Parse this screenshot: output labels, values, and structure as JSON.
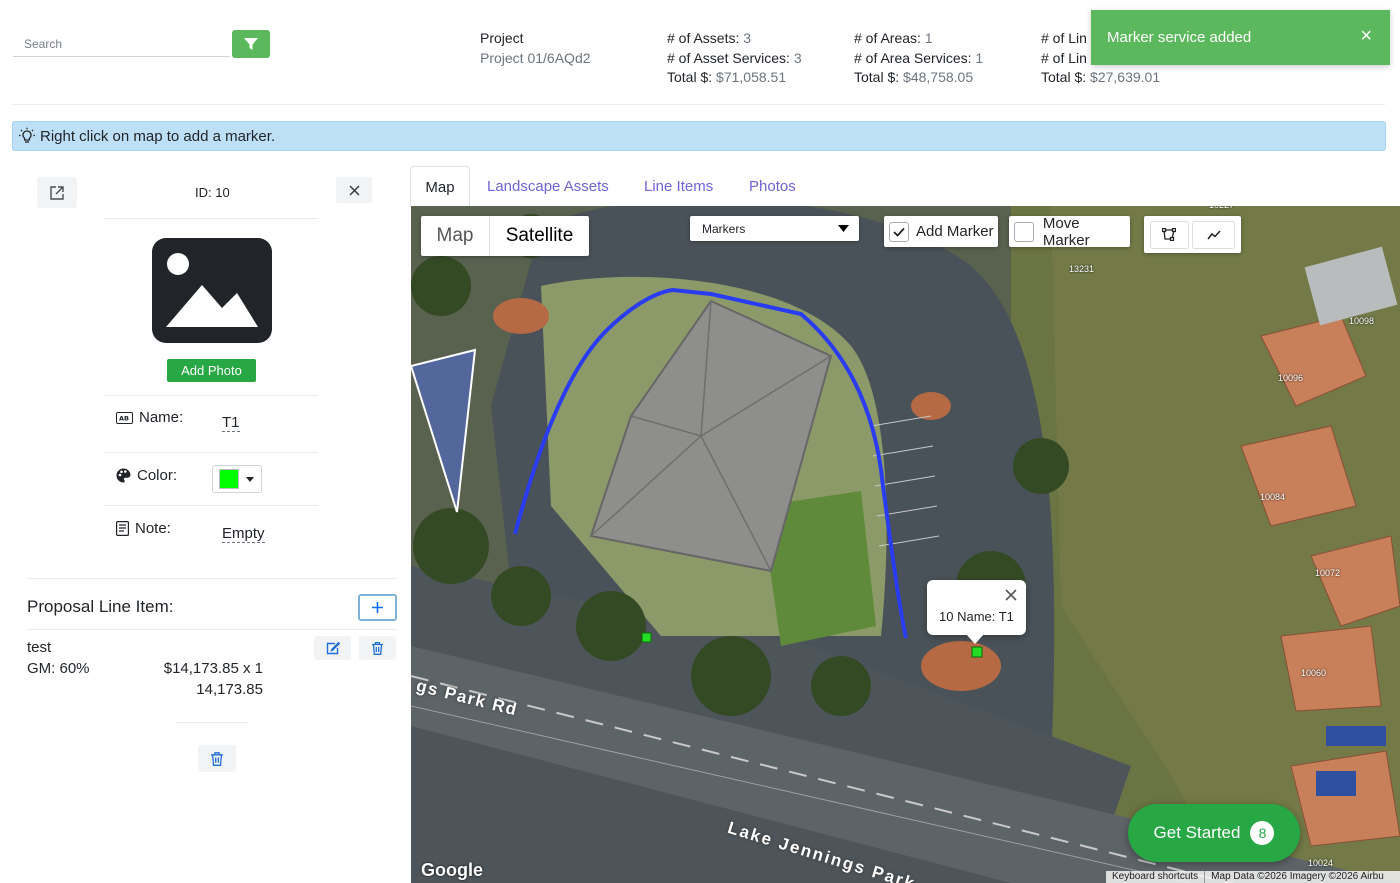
{
  "search": {
    "placeholder": "Search"
  },
  "project": {
    "label": "Project",
    "name": "Project 01/6AQd2"
  },
  "stats": {
    "assets": {
      "label": "# of Assets:",
      "value": "3",
      "services_label": "# of Asset Services:",
      "services_value": "3",
      "total_label": "Total $:",
      "total_value": "$71,058.51"
    },
    "areas": {
      "label": "# of Areas:",
      "value": "1",
      "services_label": "# of Area Services:",
      "services_value": "1",
      "total_label": "Total $:",
      "total_value": "$48,758.05"
    },
    "lines": {
      "label": "# of Lin",
      "services_label": "# of Lin",
      "total_label": "Total $:",
      "total_value": "$27,639.01"
    }
  },
  "toast": {
    "message": "Marker service added",
    "close": "×"
  },
  "info": {
    "message": "Right click on map to add a marker."
  },
  "detail": {
    "id_text": "ID: 10",
    "add_photo": "Add Photo",
    "name_label": "Name:",
    "name_value": "T1",
    "color_label": "Color:",
    "color_value": "#00ff00",
    "note_label": "Note:",
    "note_value": "Empty",
    "proposal_label": "Proposal Line Item:",
    "line_item": {
      "name": "test",
      "gm": "GM: 60%",
      "price_qty": "$14,173.85 x 1",
      "total": "14,173.85"
    }
  },
  "tabs": [
    {
      "label": "Map",
      "active": true
    },
    {
      "label": "Landscape Assets"
    },
    {
      "label": "Line Items"
    },
    {
      "label": "Photos"
    }
  ],
  "map": {
    "type_map": "Map",
    "type_satellite": "Satellite",
    "layer_select": "Markers",
    "add_marker": "Add Marker",
    "move_marker": "Move Marker",
    "add_marker_checked": true,
    "move_marker_checked": false,
    "info_window": "10 Name: T1",
    "roads": [
      "gs Park Rd",
      "Lake Jennings Park"
    ],
    "house_numbers": [
      "10227",
      "13231",
      "10098",
      "10096",
      "10084",
      "10072",
      "10060",
      "10024"
    ],
    "attribution": {
      "logo": "Google",
      "shortcuts": "Keyboard shortcuts",
      "data": "Map Data ©2026 Imagery ©2026 Airbu"
    }
  },
  "get_started": {
    "label": "Get Started",
    "count": "8"
  },
  "colors": {
    "accent_green": "#5cb85c",
    "button_green": "#28a745",
    "info_blue": "#bee0f6",
    "tab_purple": "#6f63d8",
    "polyline_blue": "#2a3cf0"
  }
}
